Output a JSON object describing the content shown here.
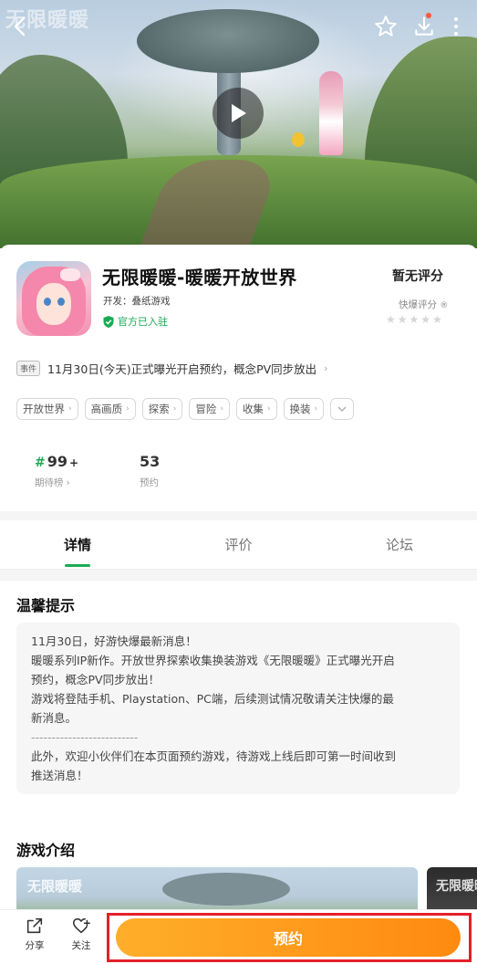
{
  "hero": {
    "watermark": "无限暖暖",
    "icons": {
      "back": "back-arrow-icon",
      "favorite": "star-icon",
      "download": "download-icon",
      "more": "more-vertical-icon",
      "play": "play-icon"
    }
  },
  "app": {
    "title": "无限暖暖-暖暖开放世界",
    "developer": "开发：叠纸游戏",
    "official_badge": "官方已入驻",
    "rating_title": "暂无评分",
    "rating_source": "快爆评分",
    "stars_total": 5,
    "stars_filled": 0
  },
  "event": {
    "tag": "事件",
    "text": "11月30日(今天)正式曝光开启预约，概念PV同步放出"
  },
  "tags": [
    "开放世界",
    "高画质",
    "探索",
    "冒险",
    "收集",
    "换装"
  ],
  "stats": {
    "rank_hash": "#",
    "rank_value": "99",
    "rank_plus": "+",
    "rank_label": "期待榜",
    "reserve_value": "53",
    "reserve_label": "预约"
  },
  "tabs": [
    "详情",
    "评价",
    "论坛"
  ],
  "active_tab": 0,
  "tips": {
    "title": "温馨提示",
    "lines": [
      "11月30日，好游快爆最新消息！",
      "暖暖系列IP新作。开放世界探索收集换装游戏《无限暖暖》正式曝光开启",
      "预约，概念PV同步放出！",
      "游戏将登陆手机、Playstation、PC端，后续测试情况敬请关注快爆的最",
      "新消息。",
      "--------------------------",
      "此外，欢迎小伙伴们在本页面预约游戏，待游戏上线后即可第一时间收到",
      "推送消息！"
    ]
  },
  "intro": {
    "title": "游戏介绍",
    "shot_logo_1": "无限暖暖",
    "shot_logo_2": "无限暖暖"
  },
  "bottombar": {
    "share": "分享",
    "follow": "关注",
    "reserve": "预约"
  },
  "colors": {
    "accent_green": "#1aaa55",
    "reserve_orange": "#ff9a1a",
    "highlight_red": "#e5202a"
  }
}
